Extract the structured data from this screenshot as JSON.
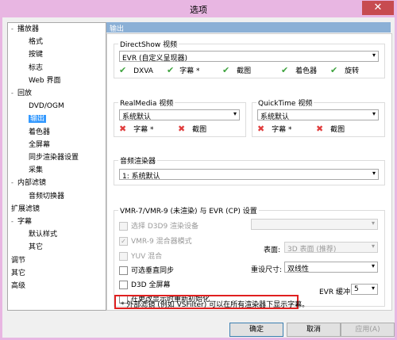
{
  "window": {
    "title": "选项",
    "close_glyph": "✕"
  },
  "tree": [
    {
      "label": "播放器",
      "toggle": "-",
      "indent": 0
    },
    {
      "label": "格式",
      "indent": 1
    },
    {
      "label": "按键",
      "indent": 1
    },
    {
      "label": "标志",
      "indent": 1
    },
    {
      "label": "Web 界面",
      "indent": 1
    },
    {
      "label": "回放",
      "toggle": "-",
      "indent": 0
    },
    {
      "label": "DVD/OGM",
      "indent": 1
    },
    {
      "label": "输出",
      "indent": 1,
      "selected": true
    },
    {
      "label": "着色器",
      "indent": 1
    },
    {
      "label": "全屏幕",
      "indent": 1
    },
    {
      "label": "同步渲染器设置",
      "indent": 1
    },
    {
      "label": "采集",
      "indent": 1
    },
    {
      "label": "内部滤镜",
      "toggle": "-",
      "indent": 0
    },
    {
      "label": "音频切换器",
      "indent": 1
    },
    {
      "label": "扩展滤镜",
      "indent": 0
    },
    {
      "label": "字幕",
      "toggle": "-",
      "indent": 0
    },
    {
      "label": "默认样式",
      "indent": 1
    },
    {
      "label": "其它",
      "indent": 1
    },
    {
      "label": "调节",
      "indent": 0
    },
    {
      "label": "其它",
      "indent": 0
    },
    {
      "label": "高级",
      "indent": 0
    }
  ],
  "section_title": "输出",
  "directshow": {
    "group_label": "DirectShow 视频",
    "select_value": "EVR (自定义呈现器)",
    "features": [
      {
        "icon": "✔",
        "label": "DXVA"
      },
      {
        "icon": "✔",
        "label": "字幕 *"
      },
      {
        "icon": "✔",
        "label": "截图"
      },
      {
        "icon": "✔",
        "label": "着色器"
      },
      {
        "icon": "✔",
        "label": "旋转"
      }
    ]
  },
  "realmedia": {
    "group_label": "RealMedia 视频",
    "select_value": "系统默认",
    "features": [
      {
        "icon": "✖",
        "label": "字幕 *"
      },
      {
        "icon": "✖",
        "label": "截图"
      }
    ]
  },
  "quicktime": {
    "group_label": "QuickTime 视频",
    "select_value": "系统默认",
    "features": [
      {
        "icon": "✖",
        "label": "字幕 *"
      },
      {
        "icon": "✖",
        "label": "截图"
      }
    ]
  },
  "audio": {
    "group_label": "音频渲染器",
    "select_value": "1: 系统默认"
  },
  "vmr": {
    "group_label": "VMR-7/VMR-9 (未渲染) 与 EVR (CP) 设置",
    "d3d9_device": "选择 D3D9 渲染设备",
    "vmr9_mix": "VMR-9 混合器模式",
    "yuv_mix": "YUV 混合",
    "vsync": "可选垂直同步",
    "d3d_fullscreen": "D3D 全屏幕",
    "reinit": "在更改显示时重新初始化",
    "surface_label": "表面:",
    "surface_value": "3D 表面 (推荐)",
    "resize_label": "重设尺寸:",
    "resize_value": "双线性",
    "evr_buffer_label": "EVR 缓冲:",
    "evr_buffer_value": "5",
    "check_glyph": "✓"
  },
  "note": "* 外部滤镜 (例如 VSFilter) 可以在所有渲染器下显示字幕。",
  "buttons": {
    "ok": "确定",
    "cancel": "取消",
    "apply": "应用(A)"
  },
  "arrow_glyph": "▾"
}
